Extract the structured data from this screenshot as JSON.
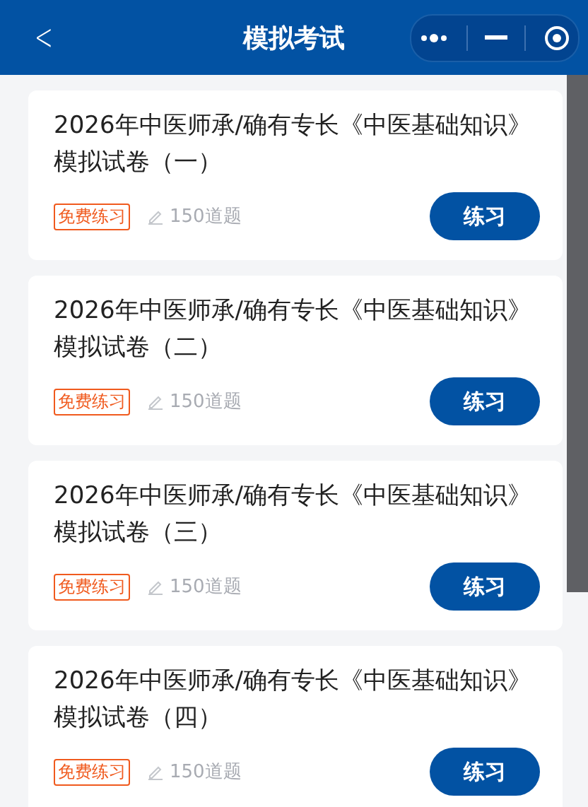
{
  "header": {
    "back": "<",
    "title": "模拟考试"
  },
  "papers": [
    {
      "title": "2026年中医师承/确有专长《中医基础知识》模拟试卷（一）",
      "tag": "免费练习",
      "count": "150道题",
      "action": "练习"
    },
    {
      "title": "2026年中医师承/确有专长《中医基础知识》模拟试卷（二）",
      "tag": "免费练习",
      "count": "150道题",
      "action": "练习"
    },
    {
      "title": "2026年中医师承/确有专长《中医基础知识》模拟试卷（三）",
      "tag": "免费练习",
      "count": "150道题",
      "action": "练习"
    },
    {
      "title": "2026年中医师承/确有专长《中医基础知识》模拟试卷（四）",
      "tag": "免费练习",
      "count": "150道题",
      "action": "练习"
    }
  ]
}
